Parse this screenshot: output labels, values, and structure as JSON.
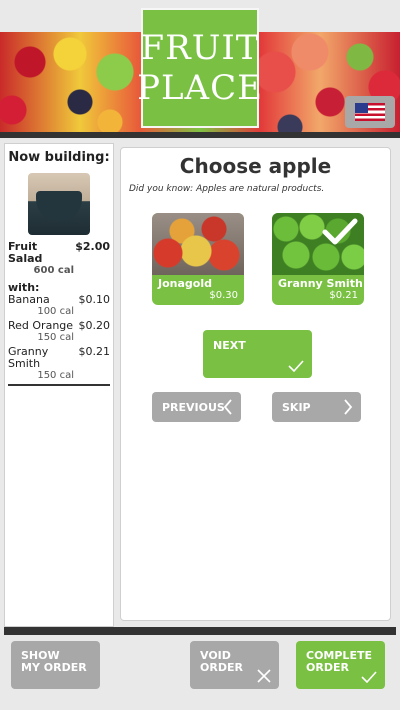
{
  "header": {
    "logo_line1": "FRUIT",
    "logo_line2": "PLACE",
    "language_icon": "us-flag-icon"
  },
  "order": {
    "title": "Now building:",
    "item_name": "Fruit Salad",
    "item_price": "$2.00",
    "item_cal": "600 cal",
    "with_label": "with:",
    "addons": [
      {
        "name": "Banana",
        "price": "$0.10",
        "cal": "100 cal"
      },
      {
        "name": "Red Orange",
        "price": "$0.20",
        "cal": "150 cal"
      },
      {
        "name": "Granny Smith",
        "price": "$0.21",
        "cal": "150 cal"
      }
    ]
  },
  "main": {
    "title": "Choose apple",
    "did_you_know": "Did you know: Apples are natural products.",
    "options": [
      {
        "name": "Jonagold",
        "price": "$0.30",
        "selected": false
      },
      {
        "name": "Granny Smith",
        "price": "$0.21",
        "selected": true
      }
    ],
    "next_label": "NEXT",
    "previous_label": "PREVIOUS",
    "skip_label": "SKIP"
  },
  "footer": {
    "show_line1": "SHOW",
    "show_line2": "MY ORDER",
    "void_line1": "VOID",
    "void_line2": "ORDER",
    "complete_line1": "COMPLETE",
    "complete_line2": "ORDER"
  },
  "colors": {
    "accent_green": "#7ac143",
    "button_grey": "#a8a8a8",
    "dark_bar": "#333333"
  }
}
